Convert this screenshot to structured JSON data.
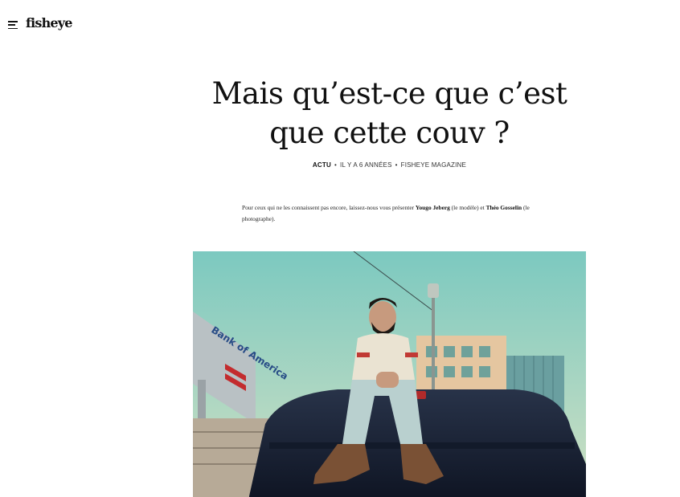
{
  "header": {
    "menu_icon": "hamburger-menu-icon",
    "logo": "fisheye"
  },
  "article": {
    "title": "Mais qu’est-ce que c’est que cette couv ?",
    "meta": {
      "category": "ACTU",
      "date": "IL Y A 6 ANNÉES",
      "author": "FISHEYE MAGAZINE"
    },
    "intro": {
      "part1": "Pour ceux qui ne les connaissent pas encore, laissez-nous vous présenter ",
      "model": "Yougo Jeberg",
      "part2": " (le modèle) et ",
      "photographer": "Théo Gosselin",
      "part3": " (le photographe)."
    },
    "hero_image": {
      "sign_text": "Bank of America"
    }
  }
}
